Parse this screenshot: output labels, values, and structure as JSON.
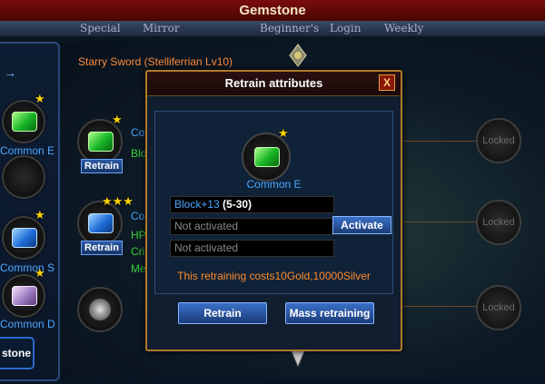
{
  "window": {
    "title": "Gemstone"
  },
  "tabs": [
    "Special",
    "Mirror",
    "Beginner's",
    "Login",
    "Weekly"
  ],
  "left_panel": {
    "gems": [
      {
        "label": "Common E",
        "color": "green"
      },
      {
        "label": "Common S",
        "color": "blue"
      },
      {
        "label": "Common D",
        "color": "pink"
      }
    ],
    "gemstone_button": "stone"
  },
  "main": {
    "item_title": "Starry Sword (Stelliferrian Lv10)",
    "slot1": {
      "label_partial": "Co",
      "stat_partial": "Blo",
      "button": "Retrain"
    },
    "slot2": {
      "label_partial": "Co",
      "stats_partial": [
        "HP",
        "Cri",
        "Me"
      ],
      "button": "Retrain"
    },
    "locked_label": "Locked"
  },
  "dialog": {
    "title": "Retrain attributes",
    "close_label": "X",
    "gem_label": "Common E",
    "attributes": [
      {
        "name": "Block+13",
        "range": "(5-30)"
      },
      {
        "name": "Not activated"
      },
      {
        "name": "Not activated"
      }
    ],
    "activate_label": "Activate",
    "cost_text": "This retraining costs10Gold,10000Silver",
    "retrain_label": "Retrain",
    "mass_retrain_label": "Mass retraining"
  },
  "colors": {
    "title_bar": "#5a0808",
    "accent_gold": "#b07a2a",
    "link_blue": "#4aa6ff",
    "cost_orange": "#ff8a2a",
    "stat_green": "#36d236"
  }
}
